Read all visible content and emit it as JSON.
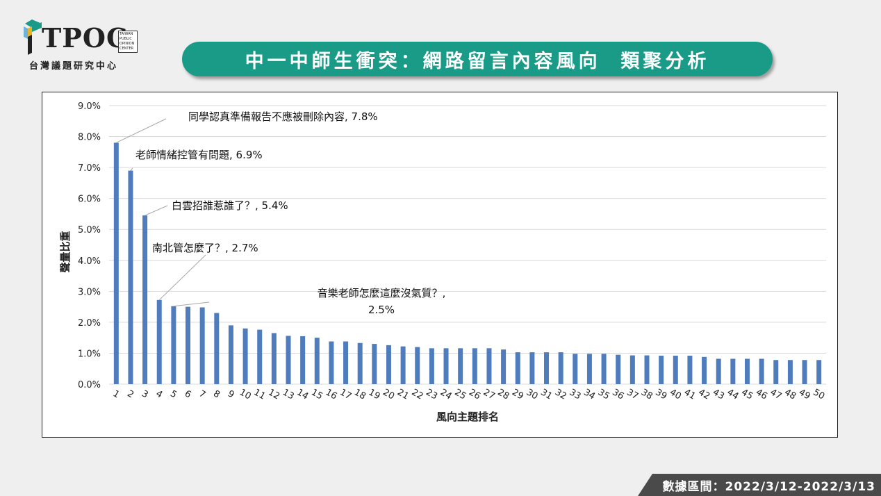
{
  "header": {
    "logo_text": "TPOC",
    "logo_small": [
      "TAIWAN",
      "PUBLIC",
      "OPINION",
      "CENTER"
    ],
    "logo_subtitle": "台灣議題研究中心",
    "title": "中一中師生衝突：網路留言內容風向  類聚分析"
  },
  "footer": {
    "date_range": "數據區間：2022/3/12-2022/3/13"
  },
  "colors": {
    "bar": "#4f7cbd",
    "banner": "#1a9b88",
    "grid": "#d9d9d9"
  },
  "chart_data": {
    "type": "bar",
    "xlabel": "風向主題排名",
    "ylabel": "聲量比重",
    "ylim": [
      0,
      9
    ],
    "yticks": [
      "0.0%",
      "1.0%",
      "2.0%",
      "3.0%",
      "4.0%",
      "5.0%",
      "6.0%",
      "7.0%",
      "8.0%",
      "9.0%"
    ],
    "categories": [
      "1",
      "2",
      "3",
      "4",
      "5",
      "6",
      "7",
      "8",
      "9",
      "10",
      "11",
      "12",
      "13",
      "14",
      "15",
      "16",
      "17",
      "18",
      "19",
      "20",
      "21",
      "22",
      "23",
      "24",
      "25",
      "26",
      "27",
      "28",
      "29",
      "30",
      "31",
      "32",
      "33",
      "34",
      "35",
      "36",
      "37",
      "38",
      "39",
      "40",
      "41",
      "42",
      "43",
      "44",
      "45",
      "46",
      "47",
      "48",
      "49",
      "50"
    ],
    "values": [
      7.8,
      6.9,
      5.45,
      2.72,
      2.52,
      2.5,
      2.48,
      2.3,
      1.9,
      1.8,
      1.76,
      1.65,
      1.56,
      1.55,
      1.5,
      1.38,
      1.38,
      1.33,
      1.3,
      1.26,
      1.22,
      1.2,
      1.16,
      1.16,
      1.16,
      1.16,
      1.16,
      1.12,
      1.03,
      1.03,
      1.03,
      1.03,
      0.98,
      0.98,
      0.98,
      0.95,
      0.93,
      0.93,
      0.92,
      0.92,
      0.92,
      0.88,
      0.82,
      0.82,
      0.82,
      0.82,
      0.78,
      0.78,
      0.78,
      0.78
    ],
    "annotations": [
      {
        "index": 0,
        "lines": [
          "同學認真準備報告不應被刪除內容, 7.8%"
        ]
      },
      {
        "index": 1,
        "lines": [
          "老師情緒控管有問題, 6.9%"
        ]
      },
      {
        "index": 2,
        "lines": [
          "白雲招誰惹誰了？, 5.4%"
        ]
      },
      {
        "index": 3,
        "lines": [
          "南北管怎麼了？, 2.7%"
        ]
      },
      {
        "index": 4,
        "lines": [
          "音樂老師怎麼這麼沒氣質？,",
          "2.5%"
        ]
      }
    ]
  }
}
